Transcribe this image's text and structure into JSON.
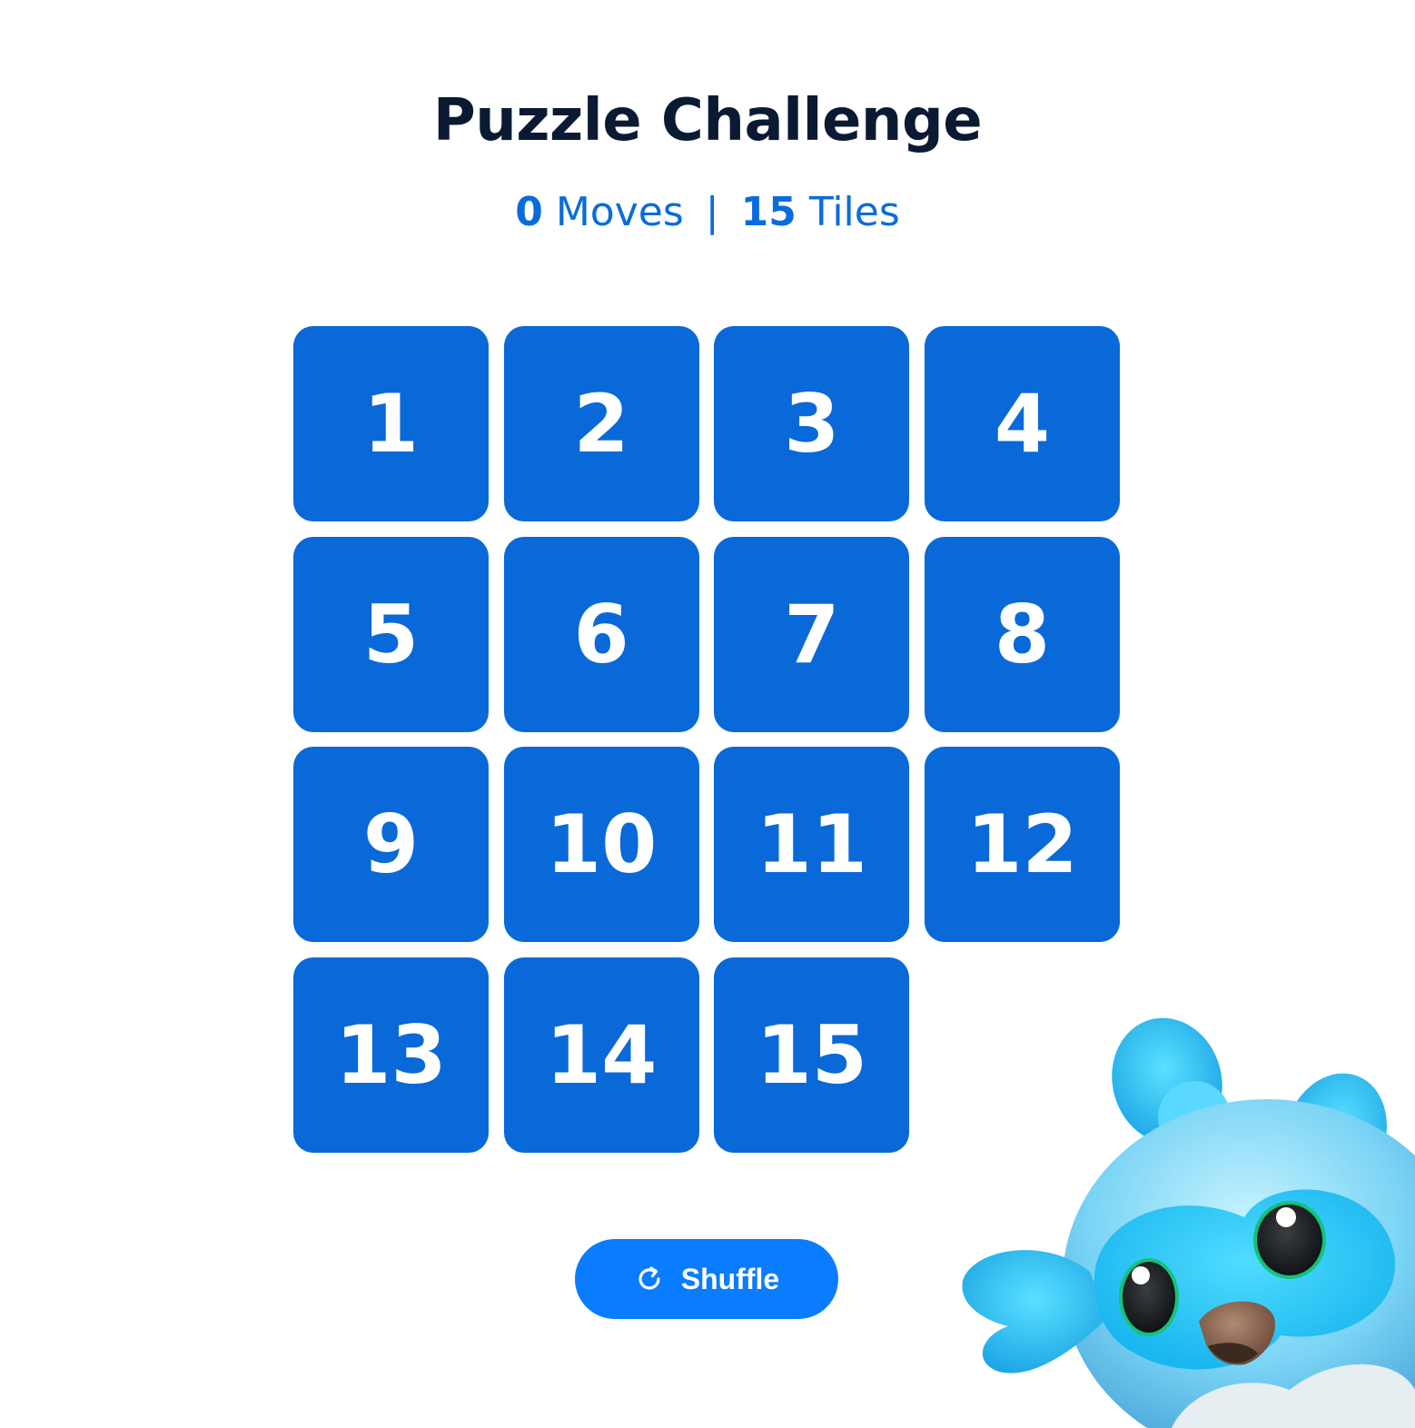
{
  "header": {
    "title": "Puzzle Challenge"
  },
  "stats": {
    "moves_count": "0",
    "moves_label": "Moves",
    "separator": "|",
    "tiles_count": "15",
    "tiles_label": "Tiles"
  },
  "board": {
    "tiles": [
      "1",
      "2",
      "3",
      "4",
      "5",
      "6",
      "7",
      "8",
      "9",
      "10",
      "11",
      "12",
      "13",
      "14",
      "15",
      ""
    ]
  },
  "actions": {
    "shuffle_label": "Shuffle",
    "shuffle_icon": "refresh-icon"
  },
  "mascot": {
    "icon": "owl-mascot"
  },
  "colors": {
    "tile": "#0969d8",
    "button": "#0a7cff",
    "title": "#0b1a33",
    "stats": "#0a6cdc"
  }
}
